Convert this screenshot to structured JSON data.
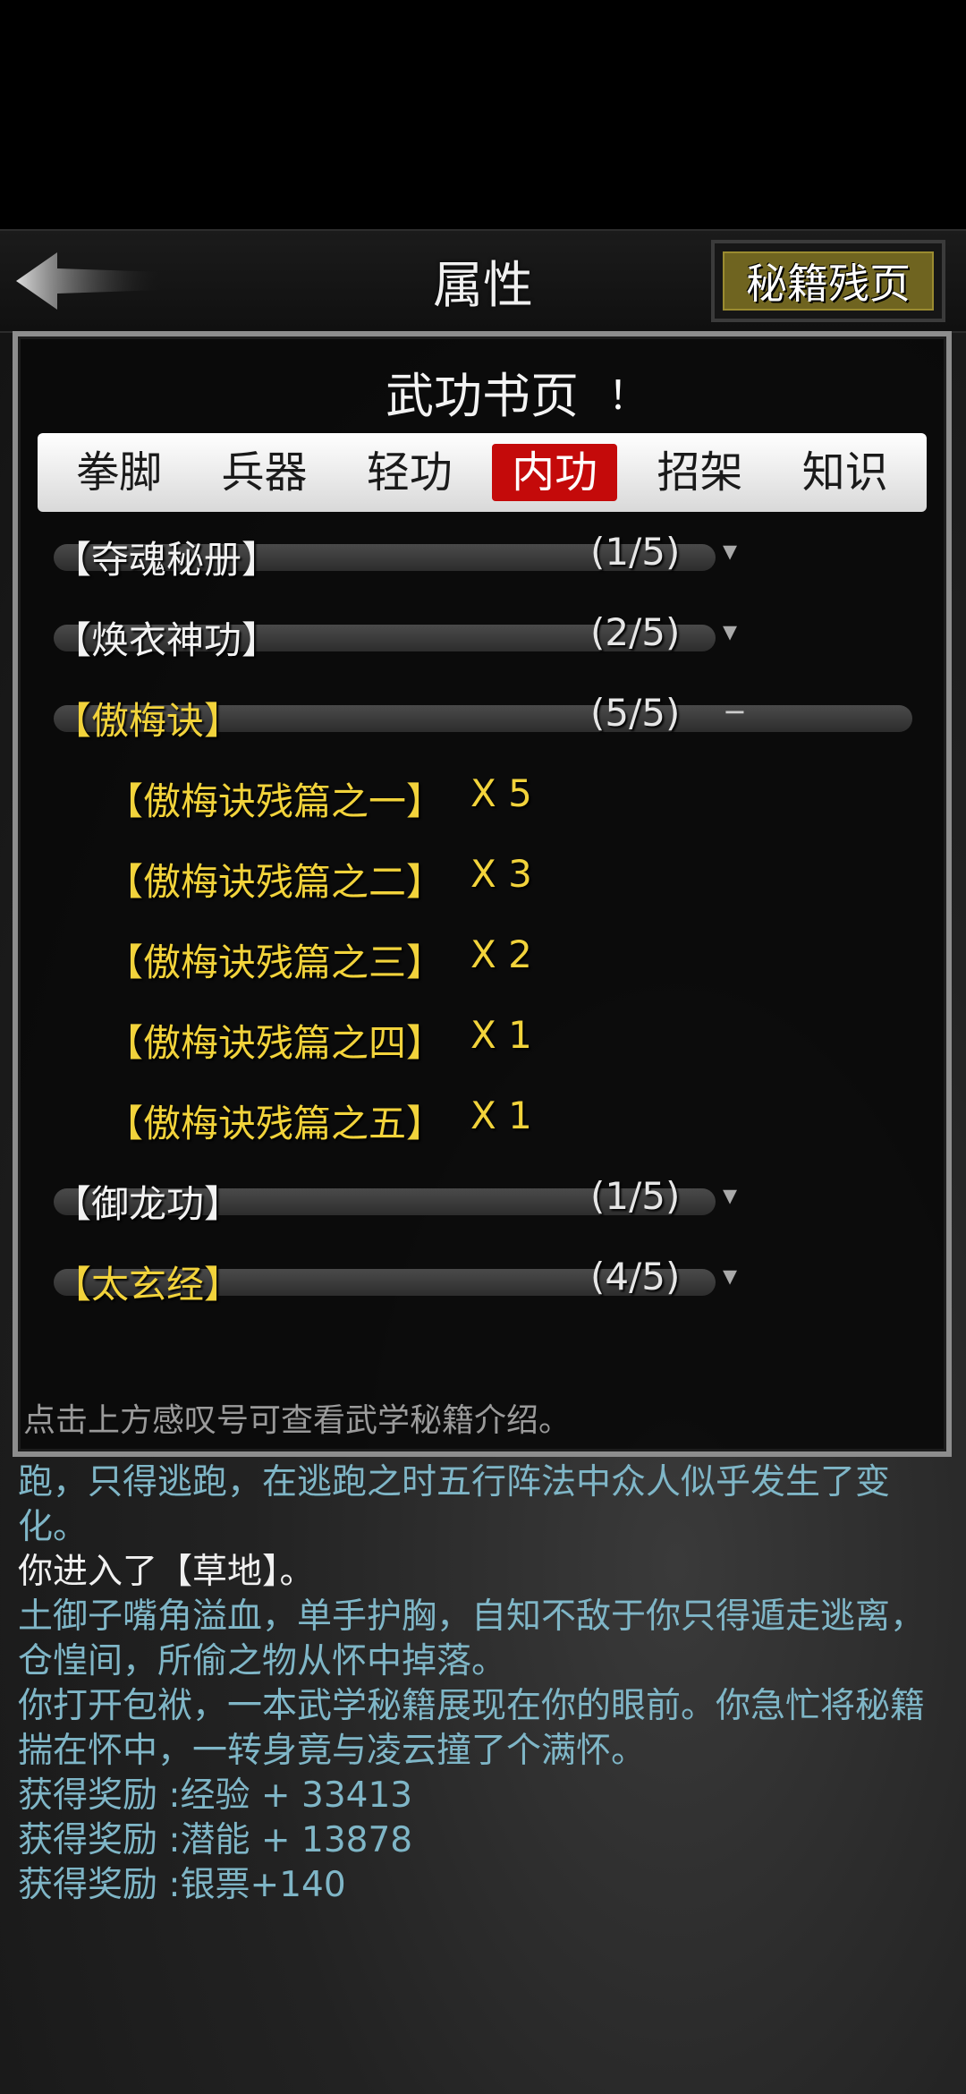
{
  "header": {
    "title": "属性",
    "right_button_label": "秘籍残页"
  },
  "modal": {
    "title": "武功书页",
    "info_icon_text": "！",
    "tabs": [
      {
        "label": "拳脚",
        "active": false
      },
      {
        "label": "兵器",
        "active": false
      },
      {
        "label": "轻功",
        "active": false
      },
      {
        "label": "内功",
        "active": true
      },
      {
        "label": "招架",
        "active": false
      },
      {
        "label": "知识",
        "active": false
      }
    ],
    "books": [
      {
        "name": "【夺魂秘册】",
        "progress": "(1/5)",
        "toggle": "▾",
        "color": "white"
      },
      {
        "name": "【焕衣神功】",
        "progress": "(2/5)",
        "toggle": "▾",
        "color": "white"
      },
      {
        "name": "【傲梅诀】",
        "progress": "(5/5)",
        "toggle": "−",
        "color": "gold"
      },
      {
        "name": "【御龙功】",
        "progress": "(1/5)",
        "toggle": "▾",
        "color": "white"
      },
      {
        "name": "【太玄经】",
        "progress": "(4/5)",
        "toggle": "▾",
        "color": "gold"
      }
    ],
    "fragments": [
      {
        "name": "【傲梅诀残篇之一】",
        "count": "X 5"
      },
      {
        "name": "【傲梅诀残篇之二】",
        "count": "X 3"
      },
      {
        "name": "【傲梅诀残篇之三】",
        "count": "X 2"
      },
      {
        "name": "【傲梅诀残篇之四】",
        "count": "X 1"
      },
      {
        "name": "【傲梅诀残篇之五】",
        "count": "X 1"
      }
    ],
    "hint": "点击上方感叹号可查看武学秘籍介绍。"
  },
  "log": [
    {
      "text": "跑，只得逃跑，在逃跑之时五行阵法中众人似乎发生了变化。",
      "color": "cyan"
    },
    {
      "text": "你进入了【草地】。",
      "color": "white"
    },
    {
      "text": "土御子嘴角溢血，单手护胸，自知不敌于你只得遁走逃离，仓惶间，所偷之物从怀中掉落。",
      "color": "cyan"
    },
    {
      "text": "你打开包袱，一本武学秘籍展现在你的眼前。你急忙将秘籍揣在怀中，一转身竟与凌云撞了个满怀。",
      "color": "cyan"
    },
    {
      "text": "获得奖励 :经验 + 33413",
      "color": "cyan"
    },
    {
      "text": "获得奖励 :潜能 + 13878",
      "color": "cyan"
    },
    {
      "text": "获得奖励 :银票+140",
      "color": "cyan"
    }
  ],
  "colors": {
    "accent_red": "#c40a0a",
    "gold_text": "#f2d33b",
    "log_cyan": "#7fb6c7",
    "button_olive": "#6f6420"
  },
  "icons": {
    "back": "back-arrow-icon",
    "info": "info-exclamation-icon",
    "collapse": "collapse-minus-icon",
    "expand": "expand-chevron-icon"
  }
}
